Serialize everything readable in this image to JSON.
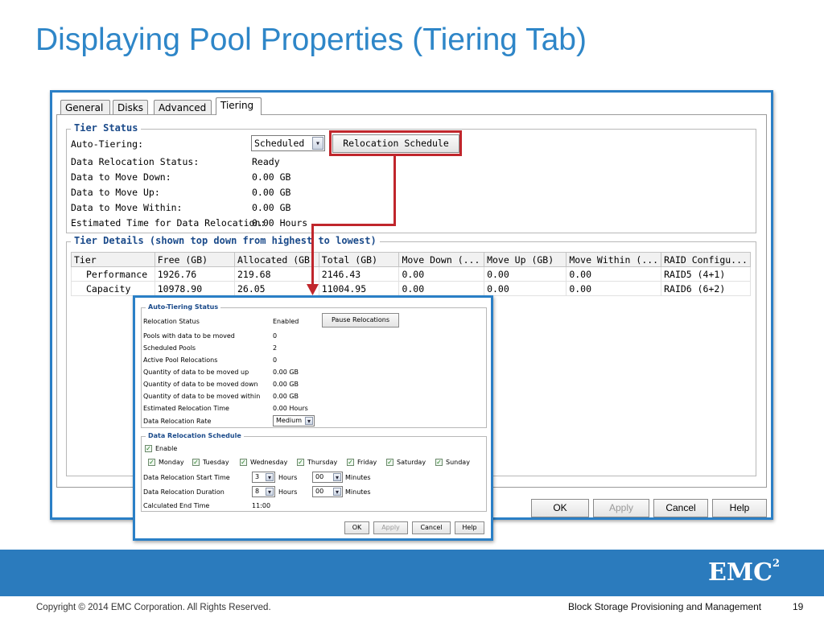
{
  "slide": {
    "title": "Displaying Pool Properties (Tiering Tab)",
    "copyright": "Copyright © 2014 EMC Corporation. All Rights Reserved.",
    "footer_title": "Block Storage Provisioning and Management",
    "page_number": "19",
    "logo_text": "EMC",
    "logo_sup": "2",
    "brand_color": "#2b7bbd",
    "highlight_color": "#c0262c"
  },
  "main_dialog": {
    "tabs": [
      "General",
      "Disks",
      "Advanced",
      "Tiering"
    ],
    "active_tab": "Tiering",
    "tier_status": {
      "legend": "Tier Status",
      "auto_tiering_label": "Auto-Tiering:",
      "auto_tiering_value": "Scheduled",
      "relocation_button": "Relocation Schedule",
      "rows": [
        {
          "label": "Data Relocation Status:",
          "value": "Ready"
        },
        {
          "label": "Data to Move Down:",
          "value": "0.00 GB"
        },
        {
          "label": "Data to Move Up:",
          "value": "0.00 GB"
        },
        {
          "label": "Data to Move Within:",
          "value": "0.00 GB"
        },
        {
          "label": "Estimated Time for Data Relocation:",
          "value": "0.00 Hours"
        }
      ]
    },
    "tier_details": {
      "legend": "Tier Details (shown top down from highest to lowest)",
      "columns": [
        "Tier",
        "Free (GB)",
        "Allocated (GB)",
        "Total (GB)",
        "Move Down (...",
        "Move Up (GB)",
        "Move Within (...",
        "RAID Configu..."
      ],
      "rows": [
        [
          "Performance",
          "1926.76",
          "219.68",
          "2146.43",
          "0.00",
          "0.00",
          "0.00",
          "RAID5 (4+1)"
        ],
        [
          "Capacity",
          "10978.90",
          "26.05",
          "11004.95",
          "0.00",
          "0.00",
          "0.00",
          "RAID6 (6+2)"
        ]
      ]
    },
    "buttons": {
      "ok": "OK",
      "apply": "Apply",
      "cancel": "Cancel",
      "help": "Help"
    }
  },
  "schedule_dialog": {
    "status_legend": "Auto-Tiering Status",
    "relocation_status_label": "Relocation Status",
    "relocation_status_value": "Enabled",
    "pause_button": "Pause Relocations",
    "rows": [
      {
        "label": "Pools with data to be moved",
        "value": "0"
      },
      {
        "label": "Scheduled Pools",
        "value": "2"
      },
      {
        "label": "Active Pool Relocations",
        "value": "0"
      },
      {
        "label": "Quantity of data to be moved up",
        "value": "0.00 GB"
      },
      {
        "label": "Quantity of data to be moved down",
        "value": "0.00 GB"
      },
      {
        "label": "Quantity of data to be moved within",
        "value": "0.00 GB"
      },
      {
        "label": "Estimated Relocation Time",
        "value": "0.00 Hours"
      }
    ],
    "rate_label": "Data Relocation Rate",
    "rate_value": "Medium",
    "schedule_legend": "Data Relocation Schedule",
    "enable_label": "Enable",
    "enable_checked": true,
    "days": [
      {
        "label": "Monday",
        "checked": true
      },
      {
        "label": "Tuesday",
        "checked": true
      },
      {
        "label": "Wednesday",
        "checked": true
      },
      {
        "label": "Thursday",
        "checked": true
      },
      {
        "label": "Friday",
        "checked": true
      },
      {
        "label": "Saturday",
        "checked": true
      },
      {
        "label": "Sunday",
        "checked": true
      }
    ],
    "start_time_label": "Data Relocation Start Time",
    "start_hours": "3",
    "start_minutes": "00",
    "duration_label": "Data Relocation Duration",
    "duration_hours": "8",
    "duration_minutes": "00",
    "hours_label": "Hours",
    "minutes_label": "Minutes",
    "end_time_label": "Calculated End Time",
    "end_time_value": "11:00",
    "buttons": {
      "ok": "OK",
      "apply": "Apply",
      "cancel": "Cancel",
      "help": "Help"
    }
  }
}
